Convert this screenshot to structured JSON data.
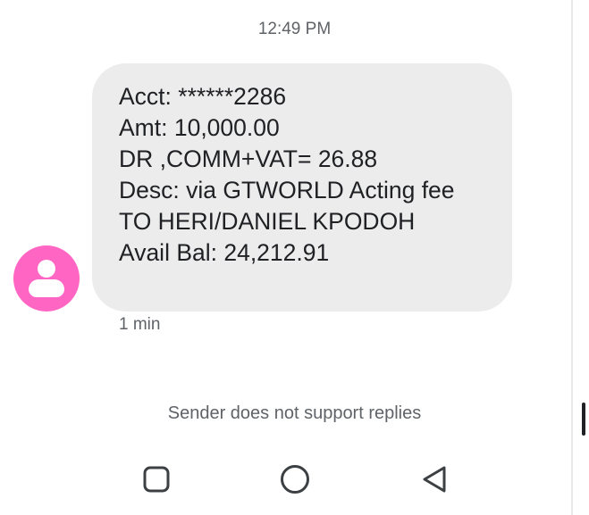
{
  "conversation": {
    "timestamp": "12:49 PM",
    "message": {
      "lines": [
        "Acct: ******2286",
        "Amt: 10,000.00",
        "DR ,COMM+VAT= 26.88",
        "Desc: via GTWORLD Acting fee",
        "TO HERI/DANIEL KPODOH",
        "Avail Bal: 24,212.91"
      ],
      "time_ago": "1 min"
    },
    "footer_notice": "Sender does not support replies"
  },
  "colors": {
    "avatar": "#ff66c4",
    "bubble": "#ececec",
    "text": "#202124",
    "secondary_text": "#5f6368"
  },
  "icons": {
    "avatar": "person-icon",
    "nav_recents": "recents-square-icon",
    "nav_home": "home-circle-icon",
    "nav_back": "back-triangle-icon"
  }
}
